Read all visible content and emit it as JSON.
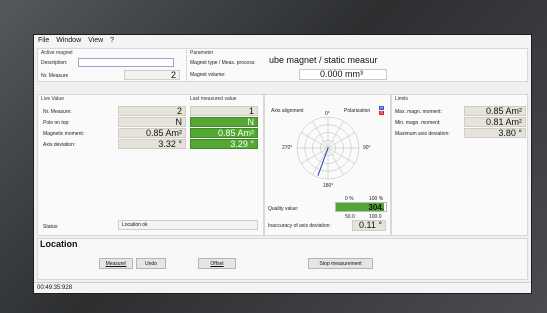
{
  "menu": [
    "File",
    "Window",
    "View",
    "?"
  ],
  "active_magnet": {
    "title": "Active magnet",
    "description_label": "Description:",
    "description_value": "",
    "nr_measure_label": "Nr. Measure",
    "nr_measure_value": "2"
  },
  "parameter": {
    "title": "Parameter",
    "magnet_type_label": "Magnet type / Meas. process:",
    "magnet_type_value": "ube magnet / static measur",
    "magnet_volume_label": "Magnet volume:",
    "magnet_volume_value": "0.000 mm³"
  },
  "live_value": {
    "title": "Live Value",
    "rows": [
      {
        "label": "Nr. Measure:",
        "value": "2"
      },
      {
        "label": "Pole on top:",
        "value": "N"
      },
      {
        "label": "Magnetic moment:",
        "value": "0.85 Am²"
      },
      {
        "label": "Axis deviation:",
        "value": "3.32 °"
      }
    ]
  },
  "last_measured": {
    "title": "Last measured value",
    "values": [
      "1",
      "N",
      "0.85 Am²",
      "3.29 °"
    ]
  },
  "axis": {
    "alignment_label": "Axis alignment",
    "polarization_label": "Polarization",
    "pol_n": "N",
    "pol_s": "S",
    "deg_0": "0°",
    "deg_90": "90°",
    "deg_180": "180°",
    "deg_270": "270°",
    "needle_angle_deg": 200
  },
  "quality": {
    "label": "Quality value:",
    "pct_0": "0 %",
    "pct_100": "100 %",
    "value": "304.",
    "fill_fraction": 0.96,
    "scale_50": "50.0",
    "scale_100": "100.0",
    "inaccuracy_label": "Inaccuracy of axis deviation:",
    "inaccuracy_value": "0.11 °"
  },
  "limits": {
    "title": "Limits",
    "rows": [
      {
        "label": "Max. magn. moment:",
        "value": "0.85 Am²"
      },
      {
        "label": "Min. magn. moment:",
        "value": "0.81 Am²"
      },
      {
        "label": "Maximum axis deviation:",
        "value": "3.80 °"
      }
    ]
  },
  "status": {
    "label": "Status:",
    "value": "Location ok"
  },
  "location": {
    "title": "Location",
    "buttons": [
      "Measure!",
      "Undo",
      "Offset",
      "Stop measurement"
    ]
  },
  "footer_time": "00:49:35:928",
  "colors": {
    "green": "#52a832",
    "north": "#2d56c8",
    "south": "#d4282e"
  }
}
